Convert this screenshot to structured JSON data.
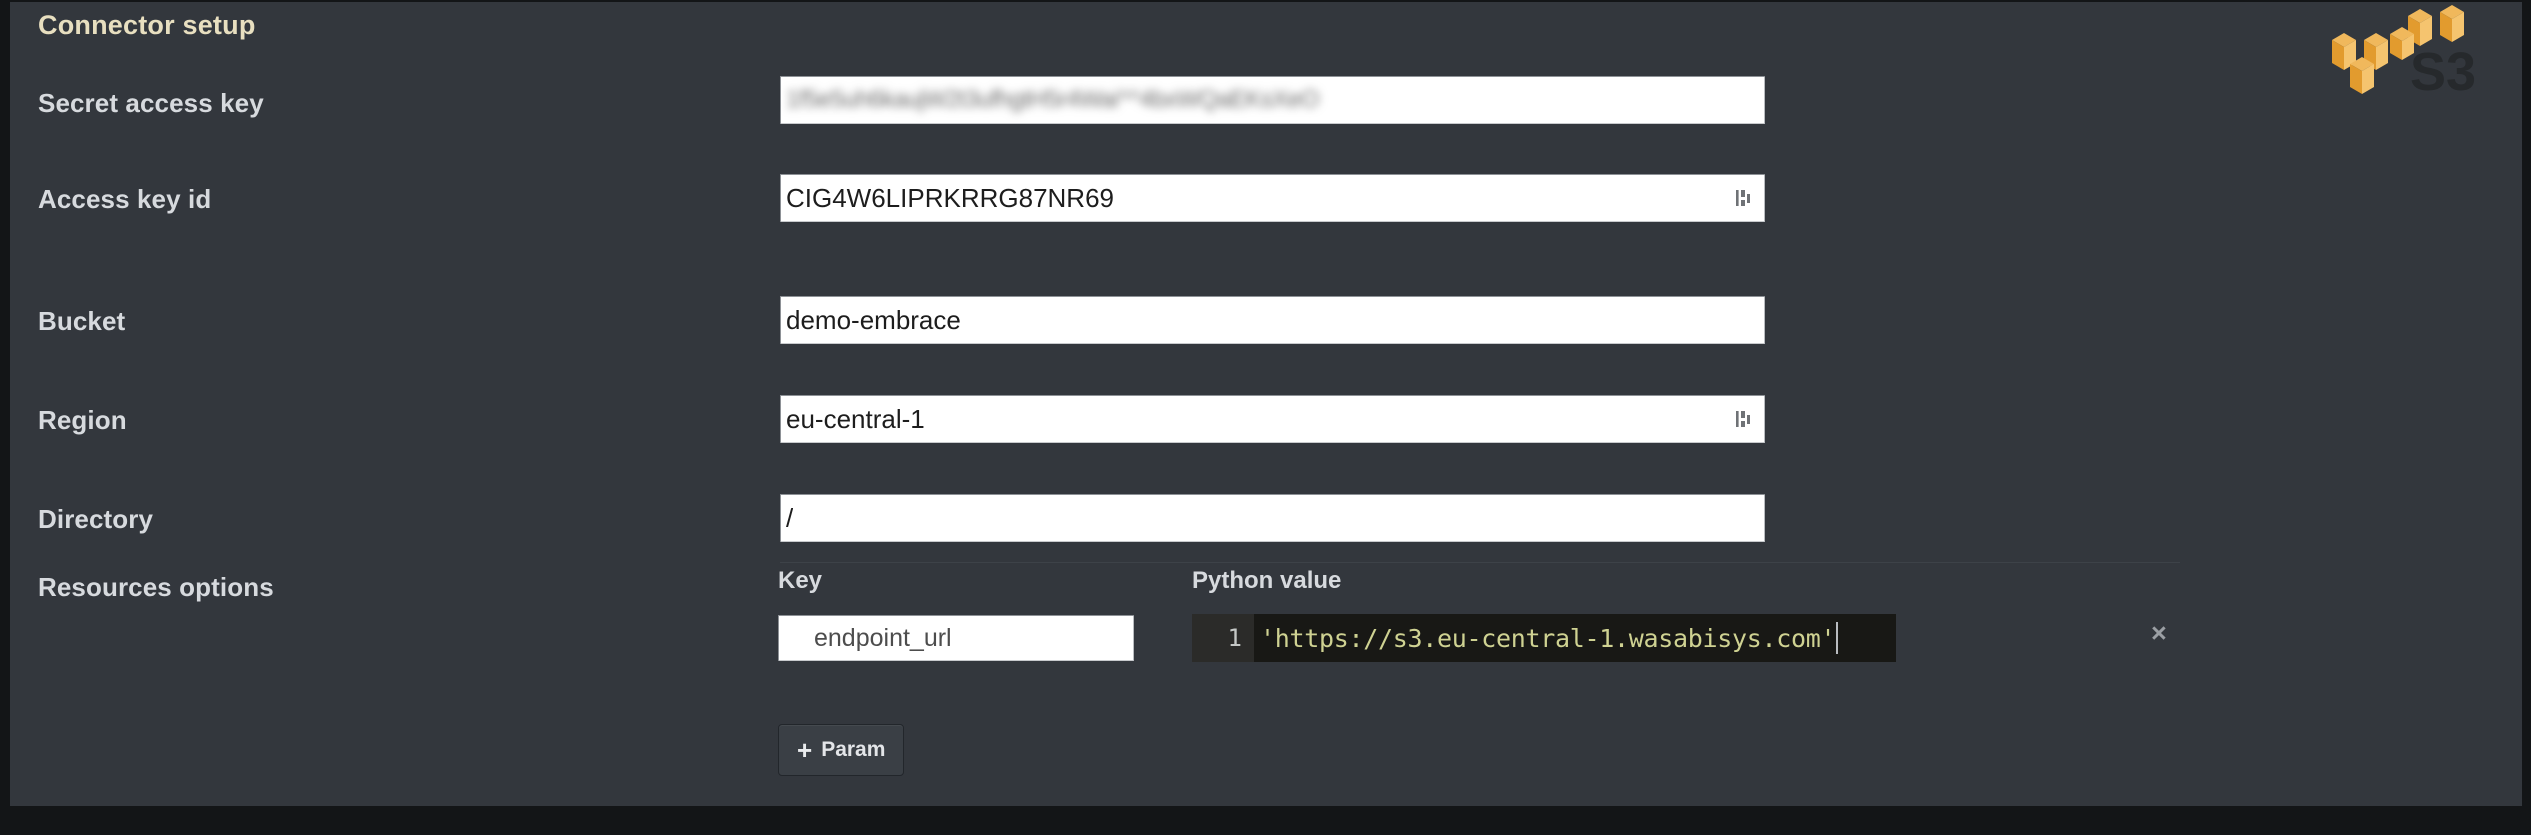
{
  "panel": {
    "title": "Connector setup",
    "brand_logo": "aws-s3-logo",
    "brand_text": "S3",
    "colors": {
      "panel_bg": "#33373d",
      "title": "#e8dfc0",
      "label": "#d7dade",
      "field_bg": "#ffffff",
      "code_string": "#cfd292",
      "code_bg": "#181815",
      "gutter_bg": "#2b2b29",
      "s3_orange": "#e8a33d",
      "button_bg": "#3a3f45"
    }
  },
  "fields": [
    {
      "label": "Secret access key",
      "value": "1f5e5uh6kaujW2t3ufhgtH5r4Wai^^4bxWQaEKsXeO",
      "placeholder": "",
      "redacted": true,
      "has_datalist": false
    },
    {
      "label": "Access key id",
      "value": "CIG4W6LIPRKRRG87NR69",
      "placeholder": "",
      "redacted": false,
      "has_datalist": true
    },
    {
      "label": "Bucket",
      "value": "demo-embrace",
      "placeholder": "",
      "redacted": false,
      "has_datalist": false
    },
    {
      "label": "Region",
      "value": "eu-central-1",
      "placeholder": "",
      "redacted": false,
      "has_datalist": true
    },
    {
      "label": "Directory",
      "value": "/",
      "placeholder": "",
      "redacted": false,
      "has_datalist": false
    }
  ],
  "resources_options": {
    "label": "Resources options",
    "columns": {
      "key": "Key",
      "value": "Python value"
    },
    "params": [
      {
        "key": "endpoint_url",
        "line_number": "1",
        "python_value": "'https://s3.eu-central-1.wasabisys.com'",
        "remove_label": "×"
      }
    ],
    "add_button": {
      "icon": "+",
      "label": "Param"
    }
  }
}
